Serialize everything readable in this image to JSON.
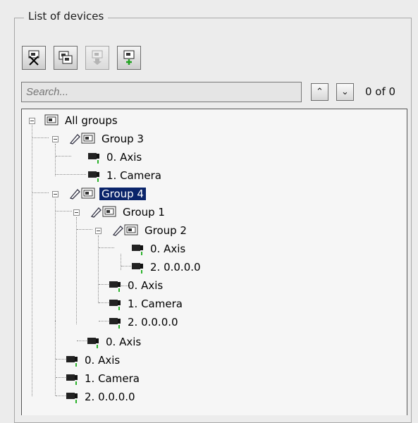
{
  "panel": {
    "legend": "List of devices",
    "toolbar": [
      {
        "name": "remove-device-icon"
      },
      {
        "name": "copy-device-icon"
      },
      {
        "name": "move-down-device-icon"
      },
      {
        "name": "add-device-icon"
      }
    ],
    "search": {
      "placeholder": "Search...",
      "value": ""
    },
    "nav": {
      "up": "^",
      "down": "v",
      "counter": "0 of 0"
    }
  },
  "tree": {
    "nodes": [
      {
        "label": "All groups"
      },
      {
        "label": "Group 3"
      },
      {
        "label": "0. Axis"
      },
      {
        "label": "1. Camera"
      },
      {
        "label": "Group 4"
      },
      {
        "label": "Group 1"
      },
      {
        "label": "Group 2"
      },
      {
        "label": "0. Axis"
      },
      {
        "label": "2. 0.0.0.0"
      },
      {
        "label": "0. Axis"
      },
      {
        "label": "1. Camera"
      },
      {
        "label": "2. 0.0.0.0"
      },
      {
        "label": "0. Axis"
      },
      {
        "label": "0. Axis"
      },
      {
        "label": "1. Camera"
      },
      {
        "label": "2. 0.0.0.0"
      }
    ]
  }
}
